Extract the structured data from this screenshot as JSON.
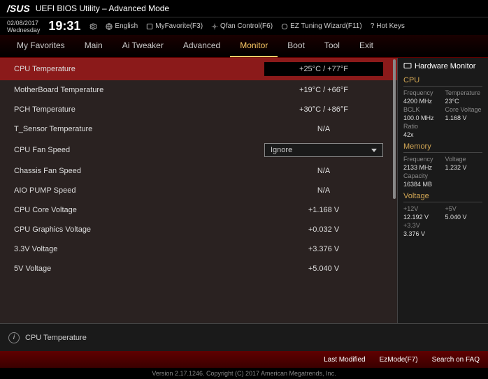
{
  "header": {
    "logo": "/SUS",
    "title": "UEFI BIOS Utility – Advanced Mode"
  },
  "topbar": {
    "date": "02/08/2017",
    "day": "Wednesday",
    "time": "19:31",
    "language": "English",
    "favorite": "MyFavorite(F3)",
    "qfan": "Qfan Control(F6)",
    "eztuning": "EZ Tuning Wizard(F11)",
    "hotkeys": "Hot Keys"
  },
  "tabs": [
    "My Favorites",
    "Main",
    "Ai Tweaker",
    "Advanced",
    "Monitor",
    "Boot",
    "Tool",
    "Exit"
  ],
  "activeTab": "Monitor",
  "rows": [
    {
      "label": "CPU Temperature",
      "value": "+25°C / +77°F",
      "selected": true
    },
    {
      "label": "MotherBoard Temperature",
      "value": "+19°C / +66°F"
    },
    {
      "label": "PCH Temperature",
      "value": "+30°C / +86°F"
    },
    {
      "label": "T_Sensor Temperature",
      "value": "N/A"
    },
    {
      "label": "CPU Fan Speed",
      "value": "Ignore",
      "dropdown": true
    },
    {
      "label": "Chassis Fan Speed",
      "value": "N/A"
    },
    {
      "label": "AIO PUMP Speed",
      "value": "N/A"
    },
    {
      "label": "CPU Core Voltage",
      "value": "+1.168 V"
    },
    {
      "label": "CPU Graphics Voltage",
      "value": "+0.032 V"
    },
    {
      "label": "3.3V Voltage",
      "value": "+3.376 V"
    },
    {
      "label": "5V Voltage",
      "value": "+5.040 V"
    }
  ],
  "sidebar": {
    "title": "Hardware Monitor",
    "cpu": {
      "heading": "CPU",
      "freq_label": "Frequency",
      "freq": "4200 MHz",
      "temp_label": "Temperature",
      "temp": "23°C",
      "bclk_label": "BCLK",
      "bclk": "100.0 MHz",
      "corev_label": "Core Voltage",
      "corev": "1.168 V",
      "ratio_label": "Ratio",
      "ratio": "42x"
    },
    "memory": {
      "heading": "Memory",
      "freq_label": "Frequency",
      "freq": "2133 MHz",
      "volt_label": "Voltage",
      "volt": "1.232 V",
      "cap_label": "Capacity",
      "cap": "16384 MB"
    },
    "voltage": {
      "heading": "Voltage",
      "v12_label": "+12V",
      "v12": "12.192 V",
      "v5_label": "+5V",
      "v5": "5.040 V",
      "v33_label": "+3.3V",
      "v33": "3.376 V"
    }
  },
  "info": "CPU Temperature",
  "footer": {
    "lastmod": "Last Modified",
    "ezmode": "EzMode(F7)",
    "search": "Search on FAQ",
    "copyright": "Version 2.17.1246. Copyright (C) 2017 American Megatrends, Inc."
  }
}
